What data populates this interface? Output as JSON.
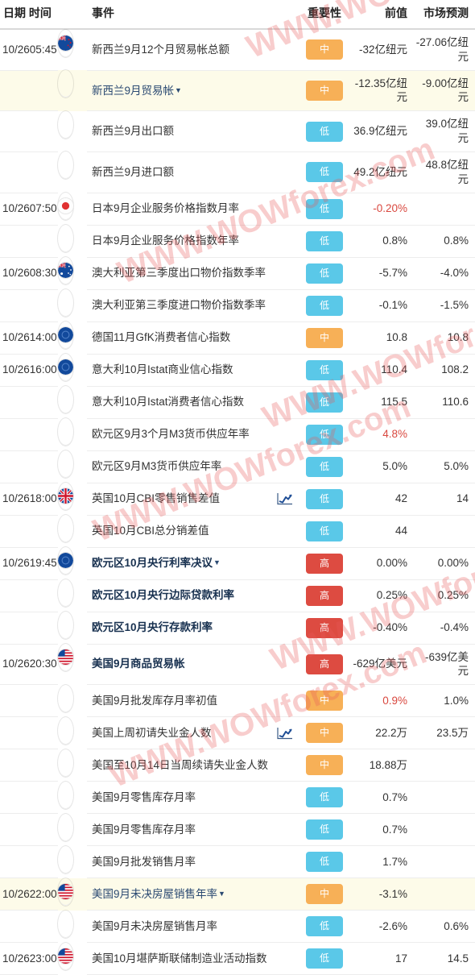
{
  "header": {
    "columns": [
      {
        "key": "date",
        "label": "日期  时间"
      },
      {
        "key": "event",
        "label": "事件"
      },
      {
        "key": "importance",
        "label": "重要性"
      },
      {
        "key": "previous",
        "label": "前值"
      },
      {
        "key": "forecast",
        "label": "市场预测"
      }
    ],
    "date_label": "日期  时间",
    "event_label": "事件",
    "importance_label": "重要性",
    "previous_label": "前值",
    "forecast_label": "市场预测"
  },
  "importance_labels": {
    "low": "低",
    "mid": "中",
    "high": "高"
  },
  "colors": {
    "low": "#5ac8e8",
    "mid": "#f7b057",
    "high": "#dd4b41",
    "highlight_row": "#fdfbe9",
    "value_red": "#d9483f",
    "text": "#333333",
    "link_text": "#2b4a72",
    "watermark": "#e95a5a"
  },
  "watermark": {
    "text": "WWW.WOWforex.com"
  },
  "rows": [
    {
      "date": "10/26",
      "time": "05:45",
      "flag": "new-zealand",
      "event": "新西兰9月12个月贸易帐总额",
      "importance": "mid",
      "previous": "-32亿纽元",
      "forecast": "-27.06亿纽元",
      "highlight": false,
      "bold": false,
      "caret": false,
      "chart_icon": false,
      "previous_red": false
    },
    {
      "date": "",
      "time": "",
      "flag": "",
      "event": "新西兰9月贸易帐",
      "importance": "mid",
      "previous": "-12.35亿纽元",
      "forecast": "-9.00亿纽元",
      "highlight": true,
      "bold": false,
      "caret": true,
      "chart_icon": false,
      "previous_red": false
    },
    {
      "date": "",
      "time": "",
      "flag": "",
      "event": "新西兰9月出口额",
      "importance": "low",
      "previous": "36.9亿纽元",
      "forecast": "39.0亿纽元",
      "highlight": false,
      "bold": false,
      "caret": false,
      "chart_icon": false,
      "previous_red": false
    },
    {
      "date": "",
      "time": "",
      "flag": "",
      "event": "新西兰9月进口额",
      "importance": "low",
      "previous": "49.2亿纽元",
      "forecast": "48.8亿纽元",
      "highlight": false,
      "bold": false,
      "caret": false,
      "chart_icon": false,
      "previous_red": false
    },
    {
      "date": "10/26",
      "time": "07:50",
      "flag": "japan",
      "event": "日本9月企业服务价格指数月率",
      "importance": "low",
      "previous": "-0.20%",
      "forecast": "",
      "highlight": false,
      "bold": false,
      "caret": false,
      "chart_icon": false,
      "previous_red": true
    },
    {
      "date": "",
      "time": "",
      "flag": "",
      "event": "日本9月企业服务价格指数年率",
      "importance": "low",
      "previous": "0.8%",
      "forecast": "0.8%",
      "highlight": false,
      "bold": false,
      "caret": false,
      "chart_icon": false,
      "previous_red": false
    },
    {
      "date": "10/26",
      "time": "08:30",
      "flag": "australia",
      "event": "澳大利亚第三季度出口物价指数季率",
      "importance": "low",
      "previous": "-5.7%",
      "forecast": "-4.0%",
      "highlight": false,
      "bold": false,
      "caret": false,
      "chart_icon": false,
      "previous_red": false
    },
    {
      "date": "",
      "time": "",
      "flag": "",
      "event": "澳大利亚第三季度进口物价指数季率",
      "importance": "low",
      "previous": "-0.1%",
      "forecast": "-1.5%",
      "highlight": false,
      "bold": false,
      "caret": false,
      "chart_icon": false,
      "previous_red": false
    },
    {
      "date": "10/26",
      "time": "14:00",
      "flag": "germany",
      "event": "德国11月GfK消费者信心指数",
      "importance": "mid",
      "previous": "10.8",
      "forecast": "10.8",
      "highlight": false,
      "bold": false,
      "caret": false,
      "chart_icon": false,
      "previous_red": false
    },
    {
      "date": "10/26",
      "time": "16:00",
      "flag": "eu",
      "event": "意大利10月Istat商业信心指数",
      "importance": "low",
      "previous": "110.4",
      "forecast": "108.2",
      "highlight": false,
      "bold": false,
      "caret": false,
      "chart_icon": false,
      "previous_red": false
    },
    {
      "date": "",
      "time": "",
      "flag": "",
      "event": "意大利10月Istat消费者信心指数",
      "importance": "low",
      "previous": "115.5",
      "forecast": "110.6",
      "highlight": false,
      "bold": false,
      "caret": false,
      "chart_icon": false,
      "previous_red": false
    },
    {
      "date": "",
      "time": "",
      "flag": "",
      "event": "欧元区9月3个月M3货币供应年率",
      "importance": "low",
      "previous": "4.8%",
      "forecast": "",
      "highlight": false,
      "bold": false,
      "caret": false,
      "chart_icon": false,
      "previous_red": true
    },
    {
      "date": "",
      "time": "",
      "flag": "",
      "event": "欧元区9月M3货币供应年率",
      "importance": "low",
      "previous": "5.0%",
      "forecast": "5.0%",
      "highlight": false,
      "bold": false,
      "caret": false,
      "chart_icon": false,
      "previous_red": false
    },
    {
      "date": "10/26",
      "time": "18:00",
      "flag": "uk",
      "event": "英国10月CBI零售销售差值",
      "importance": "low",
      "previous": "42",
      "forecast": "14",
      "highlight": false,
      "bold": false,
      "caret": false,
      "chart_icon": true,
      "previous_red": false
    },
    {
      "date": "",
      "time": "",
      "flag": "",
      "event": "英国10月CBI总分销差值",
      "importance": "low",
      "previous": "44",
      "forecast": "",
      "highlight": false,
      "bold": false,
      "caret": false,
      "chart_icon": false,
      "previous_red": false
    },
    {
      "date": "10/26",
      "time": "19:45",
      "flag": "eu",
      "event": "欧元区10月央行利率决议",
      "importance": "high",
      "previous": "0.00%",
      "forecast": "0.00%",
      "highlight": false,
      "bold": true,
      "caret": true,
      "chart_icon": false,
      "previous_red": false
    },
    {
      "date": "",
      "time": "",
      "flag": "",
      "event": "欧元区10月央行边际贷款利率",
      "importance": "high",
      "previous": "0.25%",
      "forecast": "0.25%",
      "highlight": false,
      "bold": true,
      "caret": false,
      "chart_icon": false,
      "previous_red": false
    },
    {
      "date": "",
      "time": "",
      "flag": "",
      "event": "欧元区10月央行存款利率",
      "importance": "high",
      "previous": "-0.40%",
      "forecast": "-0.4%",
      "highlight": false,
      "bold": true,
      "caret": false,
      "chart_icon": false,
      "previous_red": false
    },
    {
      "date": "10/26",
      "time": "20:30",
      "flag": "usa",
      "event": "美国9月商品贸易帐",
      "importance": "high",
      "previous": "-629亿美元",
      "forecast": "-639亿美元",
      "highlight": false,
      "bold": true,
      "caret": false,
      "chart_icon": false,
      "previous_red": false
    },
    {
      "date": "",
      "time": "",
      "flag": "",
      "event": "美国9月批发库存月率初值",
      "importance": "mid",
      "previous": "0.9%",
      "forecast": "1.0%",
      "highlight": false,
      "bold": false,
      "caret": false,
      "chart_icon": false,
      "previous_red": true
    },
    {
      "date": "",
      "time": "",
      "flag": "",
      "event": "美国上周初请失业金人数",
      "importance": "mid",
      "previous": "22.2万",
      "forecast": "23.5万",
      "highlight": false,
      "bold": false,
      "caret": false,
      "chart_icon": true,
      "previous_red": false
    },
    {
      "date": "",
      "time": "",
      "flag": "",
      "event": "美国至10月14日当周续请失业金人数",
      "importance": "mid",
      "previous": "18.88万",
      "forecast": "",
      "highlight": false,
      "bold": false,
      "caret": false,
      "chart_icon": false,
      "previous_red": false
    },
    {
      "date": "",
      "time": "",
      "flag": "",
      "event": "美国9月零售库存月率",
      "importance": "low",
      "previous": "0.7%",
      "forecast": "",
      "highlight": false,
      "bold": false,
      "caret": false,
      "chart_icon": false,
      "previous_red": false
    },
    {
      "date": "",
      "time": "",
      "flag": "",
      "event": "美国9月零售库存月率",
      "importance": "low",
      "previous": "0.7%",
      "forecast": "",
      "highlight": false,
      "bold": false,
      "caret": false,
      "chart_icon": false,
      "previous_red": false
    },
    {
      "date": "",
      "time": "",
      "flag": "",
      "event": "美国9月批发销售月率",
      "importance": "low",
      "previous": "1.7%",
      "forecast": "",
      "highlight": false,
      "bold": false,
      "caret": false,
      "chart_icon": false,
      "previous_red": false
    },
    {
      "date": "10/26",
      "time": "22:00",
      "flag": "usa",
      "event": "美国9月未决房屋销售年率",
      "importance": "mid",
      "previous": "-3.1%",
      "forecast": "",
      "highlight": true,
      "bold": false,
      "caret": true,
      "chart_icon": false,
      "previous_red": false
    },
    {
      "date": "",
      "time": "",
      "flag": "",
      "event": "美国9月未决房屋销售月率",
      "importance": "low",
      "previous": "-2.6%",
      "forecast": "0.6%",
      "highlight": false,
      "bold": false,
      "caret": false,
      "chart_icon": false,
      "previous_red": false
    },
    {
      "date": "10/26",
      "time": "23:00",
      "flag": "usa",
      "event": "美国10月堪萨斯联储制造业活动指数",
      "importance": "low",
      "previous": "17",
      "forecast": "14.5",
      "highlight": false,
      "bold": false,
      "caret": false,
      "chart_icon": false,
      "previous_red": false
    }
  ]
}
